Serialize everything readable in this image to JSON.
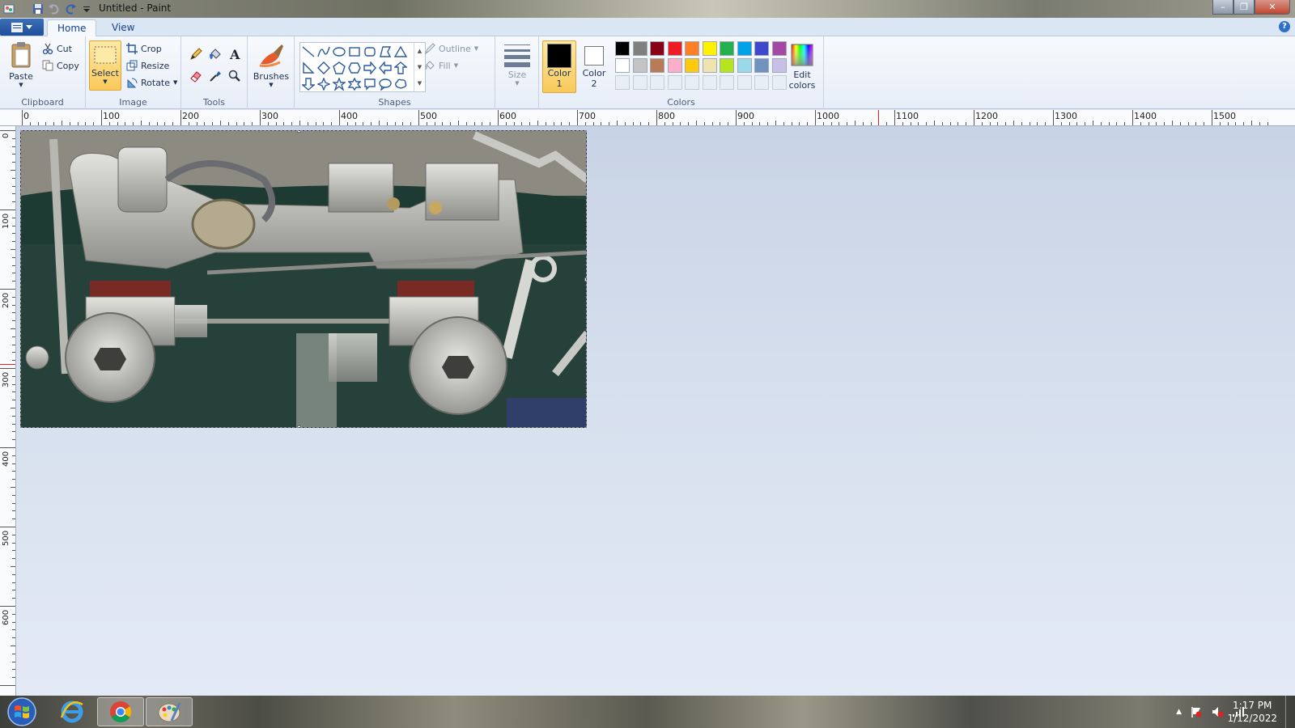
{
  "window": {
    "title": "Untitled - Paint",
    "qa_icons": [
      "paint-app-icon",
      "save-icon",
      "undo-icon",
      "redo-icon",
      "customize-arrow-icon"
    ]
  },
  "tabs": {
    "home": "Home",
    "view": "View"
  },
  "ribbon": {
    "clipboard": {
      "label": "Clipboard",
      "paste": "Paste",
      "cut": "Cut",
      "copy": "Copy"
    },
    "image": {
      "label": "Image",
      "select": "Select",
      "crop": "Crop",
      "resize": "Resize",
      "rotate": "Rotate"
    },
    "tools": {
      "label": "Tools"
    },
    "brushes": {
      "label": "Brushes"
    },
    "shapes": {
      "label": "Shapes",
      "outline": "Outline",
      "fill": "Fill"
    },
    "size": {
      "label": "Size"
    },
    "colors": {
      "label": "Colors",
      "color1_line1": "Color",
      "color1_line2": "1",
      "color2_line1": "Color",
      "color2_line2": "2",
      "edit_line1": "Edit",
      "edit_line2": "colors",
      "color1_value": "#000000",
      "color2_value": "#ffffff",
      "palette_row1": [
        "#000000",
        "#7f7f7f",
        "#880015",
        "#ed1c24",
        "#ff7f27",
        "#fff200",
        "#22b14c",
        "#00a2e8",
        "#3f48cc",
        "#a349a4"
      ],
      "palette_row2": [
        "#ffffff",
        "#c3c3c3",
        "#b97a57",
        "#ffaec9",
        "#ffc90e",
        "#efe4b0",
        "#b5e61d",
        "#99d9ea",
        "#7092be",
        "#c8bfe7"
      ]
    }
  },
  "ruler": {
    "h_labels": [
      "0",
      "100",
      "200",
      "300",
      "400",
      "500",
      "600",
      "700",
      "800",
      "900",
      "1000",
      "1100",
      "1200",
      "1300",
      "1400",
      "1500"
    ],
    "v_labels": [
      "0",
      "100",
      "200",
      "300",
      "400",
      "500",
      "600"
    ]
  },
  "taskbar": {
    "time": "1:17 PM",
    "date": "1/12/2022",
    "apps": [
      "windows-start-icon",
      "internet-explorer-icon",
      "chrome-icon",
      "paint-icon"
    ]
  }
}
